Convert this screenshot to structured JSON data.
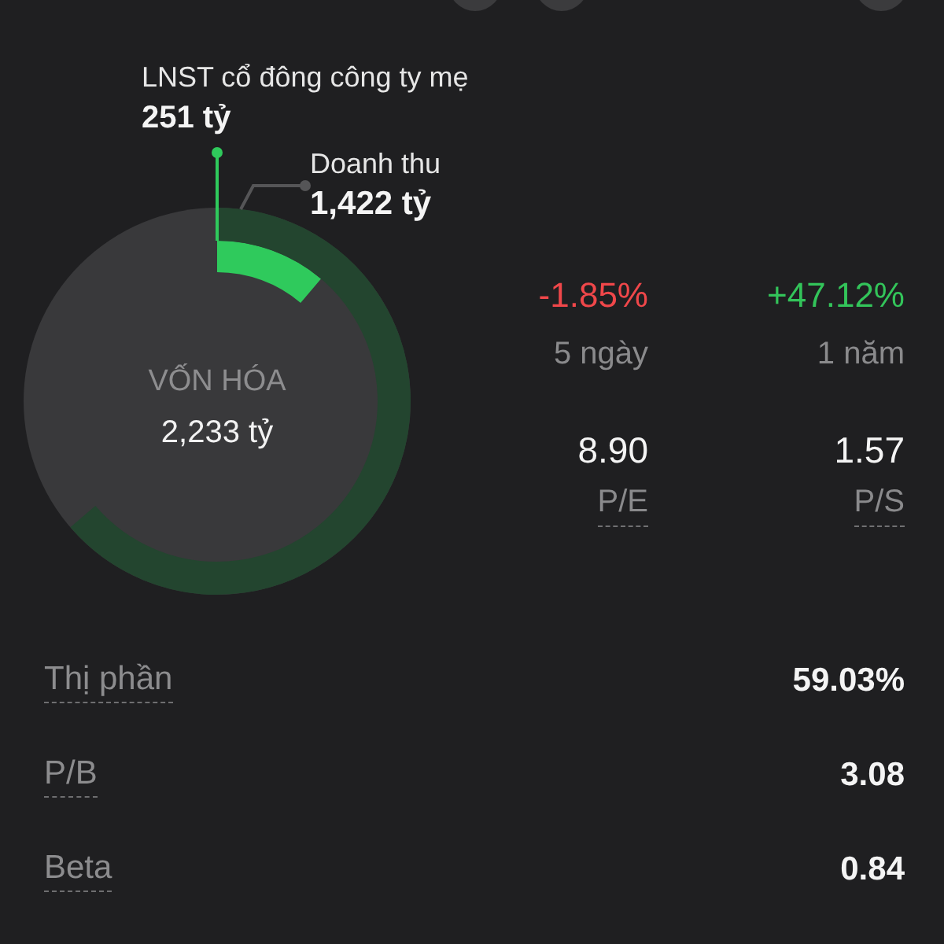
{
  "donut": {
    "center_label": "VỐN HÓA",
    "center_value": "2,233 tỷ",
    "segments": [
      {
        "kind": "profit",
        "label": "LNST cổ đông công ty mẹ",
        "value": "251 tỷ"
      },
      {
        "kind": "revenue",
        "label": "Doanh thu",
        "value": "1,422 tỷ"
      }
    ]
  },
  "changes": [
    {
      "value": "-1.85%",
      "color": "#f0474a",
      "period": "5 ngày"
    },
    {
      "value": "+47.12%",
      "color": "#33c45a",
      "period": "1 năm"
    }
  ],
  "ratios": [
    {
      "value": "8.90",
      "label": "P/E"
    },
    {
      "value": "1.57",
      "label": "P/S"
    }
  ],
  "metrics": [
    {
      "label": "Thị phần",
      "value": "59.03%"
    },
    {
      "label": "P/B",
      "value": "3.08"
    },
    {
      "label": "Beta",
      "value": "0.84"
    }
  ]
}
